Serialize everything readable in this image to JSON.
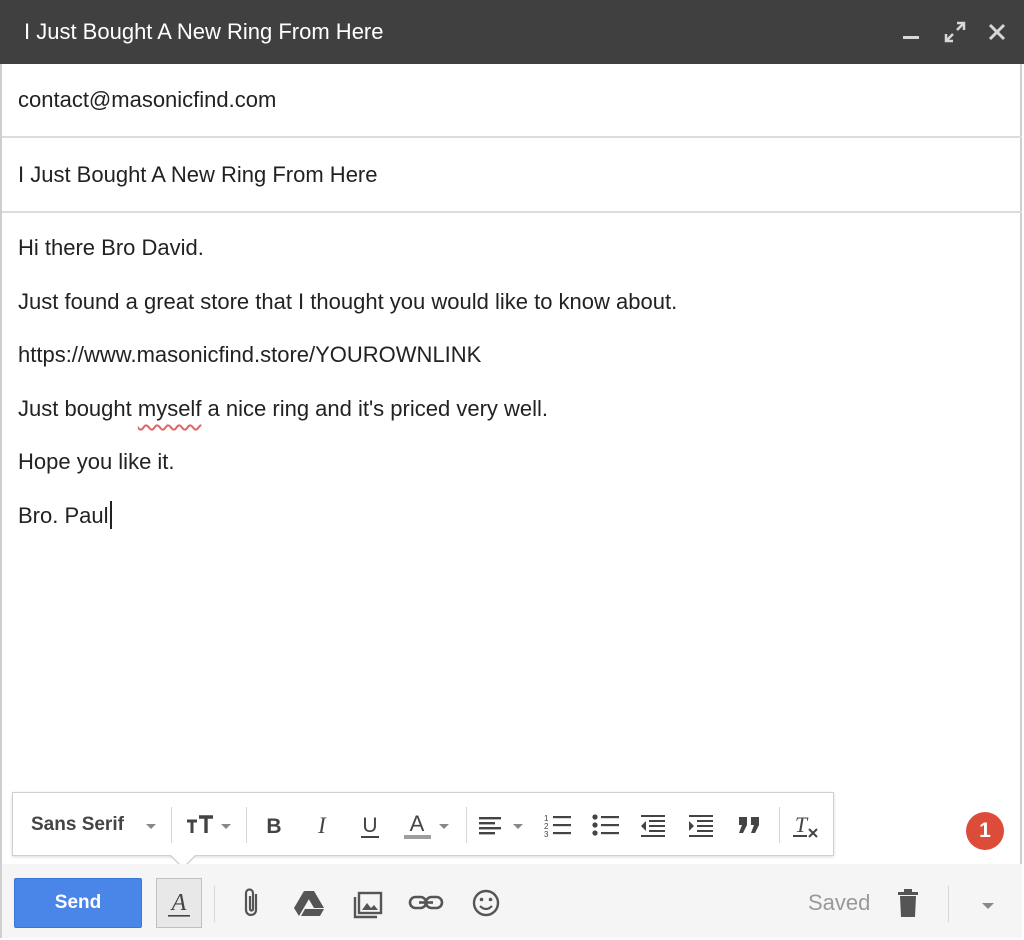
{
  "window": {
    "title": "I Just Bought A New Ring From Here"
  },
  "compose": {
    "to": "contact@masonicfind.com",
    "subject": "I Just Bought A New Ring From Here",
    "body_lines": [
      "Hi there Bro David.",
      "Just found a great store that I thought you would like to know about.",
      "https://www.masonicfind.store/YOUROWNLINK",
      "Just bought ",
      "myself",
      " a nice ring and it's priced very well.",
      "Hope you like it.",
      "Bro. Paul"
    ]
  },
  "format_toolbar": {
    "font_family": "Sans Serif"
  },
  "bottom_toolbar": {
    "send_label": "Send",
    "saved_label": "Saved"
  },
  "notification_badge": "1",
  "colors": {
    "titlebar": "#404040",
    "send_button": "#4a86e8",
    "badge": "#dd4b39",
    "spellcheck_underline": "#e06666"
  }
}
